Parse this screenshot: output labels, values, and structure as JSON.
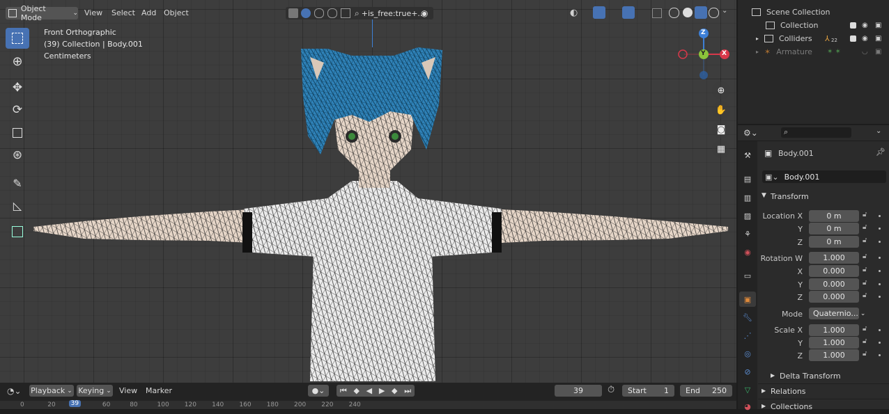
{
  "viewport_header": {
    "mode_label": "Object Mode",
    "menus": [
      "View",
      "Select",
      "Add",
      "Object"
    ],
    "filter_text": "+is_free:true+..."
  },
  "viewport_info": {
    "view_name": "Front Orthographic",
    "collection_line": "(39) Collection | Body.001",
    "units": "Centimeters"
  },
  "gizmo": {
    "z": "Z",
    "y": "Y",
    "x": "X"
  },
  "outliner": {
    "scene_collection": "Scene Collection",
    "items": [
      {
        "label": "Collection"
      },
      {
        "label": "Colliders",
        "badge": "22"
      },
      {
        "label": "Armature"
      }
    ]
  },
  "properties": {
    "object_name": "Body.001",
    "object_field": "Body.001",
    "transform_title": "Transform",
    "location_label": "Location X",
    "y_label": "Y",
    "z_label": "Z",
    "x_label": "X",
    "w_label": "Rotation W",
    "location": {
      "x": "0 m",
      "y": "0 m",
      "z": "0 m"
    },
    "rotation": {
      "w": "1.000",
      "x": "0.000",
      "y": "0.000",
      "z": "0.000"
    },
    "mode_label": "Mode",
    "mode_value": "Quaternio...",
    "scale_label": "Scale X",
    "scale": {
      "x": "1.000",
      "y": "1.000",
      "z": "1.000"
    },
    "delta_transform": "Delta Transform",
    "relations": "Relations",
    "collections": "Collections"
  },
  "timeline": {
    "menus": [
      "Playback",
      "Keying",
      "View",
      "Marker"
    ],
    "current_frame": "39",
    "start_label": "Start",
    "start_value": "1",
    "end_label": "End",
    "end_value": "250",
    "ruler": [
      "0",
      "20",
      "39",
      "60",
      "80",
      "100",
      "120",
      "140",
      "160",
      "180",
      "200",
      "220",
      "240"
    ]
  },
  "colors": {
    "accent": "#4772b3",
    "axis_x": "#d8384a",
    "axis_y": "#8bc43a",
    "axis_z": "#3d7fd6",
    "hair": "#2f82b8"
  }
}
